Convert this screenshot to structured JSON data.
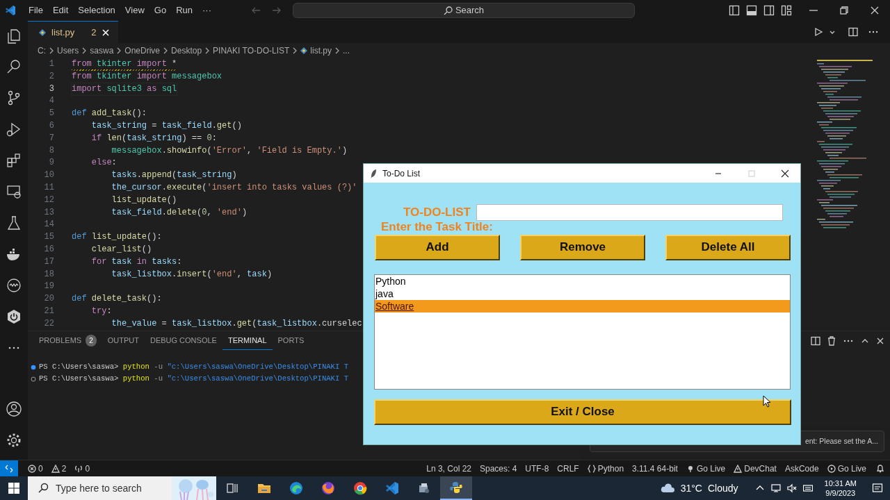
{
  "title_bar": {
    "menus": [
      "File",
      "Edit",
      "Selection",
      "View",
      "Go",
      "Run",
      "···"
    ],
    "search_placeholder": "Search"
  },
  "editor_tab": {
    "label": "list.py",
    "problem_count": "2"
  },
  "breadcrumb": [
    "C:",
    "Users",
    "saswa",
    "OneDrive",
    "Desktop",
    "PINAKI TO-DO-LIST",
    "list.py",
    "..."
  ],
  "code_lines": [
    {
      "number": "1",
      "current": false,
      "warning": true,
      "tokens": [
        {
          "kind": "kw",
          "text": "from "
        },
        {
          "kind": "mod",
          "text": "tkinter "
        },
        {
          "kind": "kw",
          "text": "import"
        },
        {
          "kind": "plain",
          "text": " *"
        }
      ]
    },
    {
      "number": "2",
      "current": false,
      "warning": false,
      "tokens": [
        {
          "kind": "kw",
          "text": "from "
        },
        {
          "kind": "mod",
          "text": "tkinter "
        },
        {
          "kind": "kw",
          "text": "import "
        },
        {
          "kind": "mod",
          "text": "messagebox"
        }
      ]
    },
    {
      "number": "3",
      "current": true,
      "warning": false,
      "tokens": [
        {
          "kind": "kw",
          "text": "import "
        },
        {
          "kind": "mod",
          "text": "sqlite3 "
        },
        {
          "kind": "kw",
          "text": "as "
        },
        {
          "kind": "mod",
          "text": "sql"
        }
      ]
    },
    {
      "number": "4",
      "current": false,
      "warning": false
    },
    {
      "number": "5",
      "current": false,
      "warning": false,
      "tokens": [
        {
          "kind": "def",
          "text": "def "
        },
        {
          "kind": "fn",
          "text": "add_task"
        },
        {
          "kind": "plain",
          "text": "():"
        }
      ]
    },
    {
      "number": "6",
      "current": false,
      "warning": false,
      "tokens": [
        {
          "kind": "var",
          "text": "    task_string"
        },
        {
          "kind": "plain",
          "text": " = "
        },
        {
          "kind": "var",
          "text": "task_field"
        },
        {
          "kind": "plain",
          "text": "."
        },
        {
          "kind": "fn",
          "text": "get"
        },
        {
          "kind": "plain",
          "text": "()"
        }
      ]
    },
    {
      "number": "7",
      "current": false,
      "warning": false,
      "tokens": [
        {
          "kind": "kw",
          "text": "    if "
        },
        {
          "kind": "fn",
          "text": "len"
        },
        {
          "kind": "plain",
          "text": "("
        },
        {
          "kind": "var",
          "text": "task_string"
        },
        {
          "kind": "plain",
          "text": ") == "
        },
        {
          "kind": "num",
          "text": "0"
        },
        {
          "kind": "plain",
          "text": ":"
        }
      ]
    },
    {
      "number": "8",
      "current": false,
      "warning": false,
      "tokens": [
        {
          "kind": "mod",
          "text": "        messagebox"
        },
        {
          "kind": "plain",
          "text": "."
        },
        {
          "kind": "fn",
          "text": "showinfo"
        },
        {
          "kind": "plain",
          "text": "("
        },
        {
          "kind": "str",
          "text": "'Error'"
        },
        {
          "kind": "plain",
          "text": ", "
        },
        {
          "kind": "str",
          "text": "'Field is Empty.'"
        },
        {
          "kind": "plain",
          "text": ")"
        }
      ]
    },
    {
      "number": "9",
      "current": false,
      "warning": false,
      "tokens": [
        {
          "kind": "kw",
          "text": "    else"
        },
        {
          "kind": "plain",
          "text": ":"
        }
      ]
    },
    {
      "number": "10",
      "current": false,
      "warning": false,
      "tokens": [
        {
          "kind": "var",
          "text": "        tasks"
        },
        {
          "kind": "plain",
          "text": "."
        },
        {
          "kind": "fn",
          "text": "append"
        },
        {
          "kind": "plain",
          "text": "("
        },
        {
          "kind": "var",
          "text": "task_string"
        },
        {
          "kind": "plain",
          "text": ")"
        }
      ]
    },
    {
      "number": "11",
      "current": false,
      "warning": false,
      "tokens": [
        {
          "kind": "var",
          "text": "        the_cursor"
        },
        {
          "kind": "plain",
          "text": "."
        },
        {
          "kind": "fn",
          "text": "execute"
        },
        {
          "kind": "plain",
          "text": "("
        },
        {
          "kind": "str",
          "text": "'insert into tasks values (?)'"
        }
      ]
    },
    {
      "number": "12",
      "current": false,
      "warning": false,
      "tokens": [
        {
          "kind": "fn",
          "text": "        list_update"
        },
        {
          "kind": "plain",
          "text": "()"
        }
      ]
    },
    {
      "number": "13",
      "current": false,
      "warning": false,
      "tokens": [
        {
          "kind": "var",
          "text": "        task_field"
        },
        {
          "kind": "plain",
          "text": "."
        },
        {
          "kind": "fn",
          "text": "delete"
        },
        {
          "kind": "plain",
          "text": "("
        },
        {
          "kind": "num",
          "text": "0"
        },
        {
          "kind": "plain",
          "text": ", "
        },
        {
          "kind": "str",
          "text": "'end'"
        },
        {
          "kind": "plain",
          "text": ")"
        }
      ]
    },
    {
      "number": "14",
      "current": false,
      "warning": false
    },
    {
      "number": "15",
      "current": false,
      "warning": false,
      "tokens": [
        {
          "kind": "def",
          "text": "def "
        },
        {
          "kind": "fn",
          "text": "list_update"
        },
        {
          "kind": "plain",
          "text": "():"
        }
      ]
    },
    {
      "number": "16",
      "current": false,
      "warning": false,
      "tokens": [
        {
          "kind": "fn",
          "text": "    clear_list"
        },
        {
          "kind": "plain",
          "text": "()"
        }
      ]
    },
    {
      "number": "17",
      "current": false,
      "warning": false,
      "tokens": [
        {
          "kind": "kw",
          "text": "    for "
        },
        {
          "kind": "var",
          "text": "task "
        },
        {
          "kind": "kw",
          "text": "in "
        },
        {
          "kind": "var",
          "text": "tasks"
        },
        {
          "kind": "plain",
          "text": ":"
        }
      ]
    },
    {
      "number": "18",
      "current": false,
      "warning": false,
      "tokens": [
        {
          "kind": "var",
          "text": "        task_listbox"
        },
        {
          "kind": "plain",
          "text": "."
        },
        {
          "kind": "fn",
          "text": "insert"
        },
        {
          "kind": "plain",
          "text": "("
        },
        {
          "kind": "str",
          "text": "'end'"
        },
        {
          "kind": "plain",
          "text": ", "
        },
        {
          "kind": "var",
          "text": "task"
        },
        {
          "kind": "plain",
          "text": ")"
        }
      ]
    },
    {
      "number": "19",
      "current": false,
      "warning": false
    },
    {
      "number": "20",
      "current": false,
      "warning": false,
      "tokens": [
        {
          "kind": "def",
          "text": "def "
        },
        {
          "kind": "fn",
          "text": "delete_task"
        },
        {
          "kind": "plain",
          "text": "():"
        }
      ]
    },
    {
      "number": "21",
      "current": false,
      "warning": false,
      "tokens": [
        {
          "kind": "kw",
          "text": "    try"
        },
        {
          "kind": "plain",
          "text": ":"
        }
      ]
    },
    {
      "number": "22",
      "current": false,
      "warning": false,
      "tokens": [
        {
          "kind": "var",
          "text": "        the_value"
        },
        {
          "kind": "plain",
          "text": " = "
        },
        {
          "kind": "var",
          "text": "task_listbox"
        },
        {
          "kind": "plain",
          "text": "."
        },
        {
          "kind": "fn",
          "text": "get"
        },
        {
          "kind": "plain",
          "text": "("
        },
        {
          "kind": "var",
          "text": "task_listbox"
        },
        {
          "kind": "plain",
          "text": ".curselec"
        }
      ]
    }
  ],
  "panel": {
    "tabs": [
      {
        "label": "PROBLEMS",
        "badge": "2",
        "selected": false
      },
      {
        "label": "OUTPUT",
        "selected": false
      },
      {
        "label": "DEBUG CONSOLE",
        "selected": false
      },
      {
        "label": "TERMINAL",
        "selected": true
      },
      {
        "label": "PORTS",
        "selected": false
      }
    ],
    "terminal_lines": [
      {
        "kind": "done",
        "prompt": "PS C:\\Users\\saswa>",
        "command": "python",
        "flag": "-u",
        "argument": "\"c:\\Users\\saswa\\OneDrive\\Desktop\\PINAKI T"
      },
      {
        "kind": "running",
        "prompt": "PS C:\\Users\\saswa>",
        "command": "python",
        "flag": "-u",
        "argument": "\"c:\\Users\\saswa\\OneDrive\\Desktop\\PINAKI T"
      }
    ]
  },
  "notification": {
    "text": "ent: Please set the A..."
  },
  "status_bar": {
    "left": [
      {
        "kind": "error",
        "text": "0"
      },
      {
        "kind": "warning",
        "text": "2"
      },
      {
        "kind": "ports",
        "text": "0"
      }
    ],
    "right": [
      {
        "text": "Ln 3, Col 22"
      },
      {
        "text": "Spaces: 4"
      },
      {
        "text": "UTF-8"
      },
      {
        "text": "CRLF"
      },
      {
        "kind": "braces",
        "text": "Python"
      },
      {
        "text": "3.11.4 64-bit"
      },
      {
        "kind": "broadcast",
        "text": "Go Live"
      },
      {
        "kind": "warning",
        "text": "DevChat"
      },
      {
        "text": "AskCode"
      },
      {
        "kind": "radio",
        "text": "Go Live"
      }
    ]
  },
  "dialog": {
    "title": "To-Do List",
    "controls": [
      {
        "kind": "minimize",
        "disabled": false
      },
      {
        "kind": "maximize",
        "disabled": true
      },
      {
        "kind": "close",
        "disabled": false
      }
    ],
    "heading": "TO-DO-LIST",
    "prompt": "Enter the Task Title:",
    "buttons": [
      "Add",
      "Remove",
      "Delete All"
    ],
    "tasks": [
      {
        "text": "Python",
        "selected": false
      },
      {
        "text": "java",
        "selected": false
      },
      {
        "text": "Software",
        "selected": true
      }
    ],
    "exit_button": "Exit / Close"
  },
  "taskbar": {
    "search_placeholder": "Type here to search",
    "apps": [
      {
        "kind": "task-view",
        "selected": false
      },
      {
        "kind": "folder",
        "selected": false
      },
      {
        "kind": "edge",
        "selected": false
      },
      {
        "kind": "firefox",
        "selected": false
      },
      {
        "kind": "chrome",
        "selected": false
      },
      {
        "kind": "vscode",
        "selected": false
      },
      {
        "kind": "tool",
        "selected": false
      },
      {
        "kind": "python",
        "selected": true
      }
    ],
    "weather": {
      "temperature": "31°C",
      "condition": "Cloudy"
    },
    "time": "10:31 AM",
    "date": "9/9/2023"
  }
}
